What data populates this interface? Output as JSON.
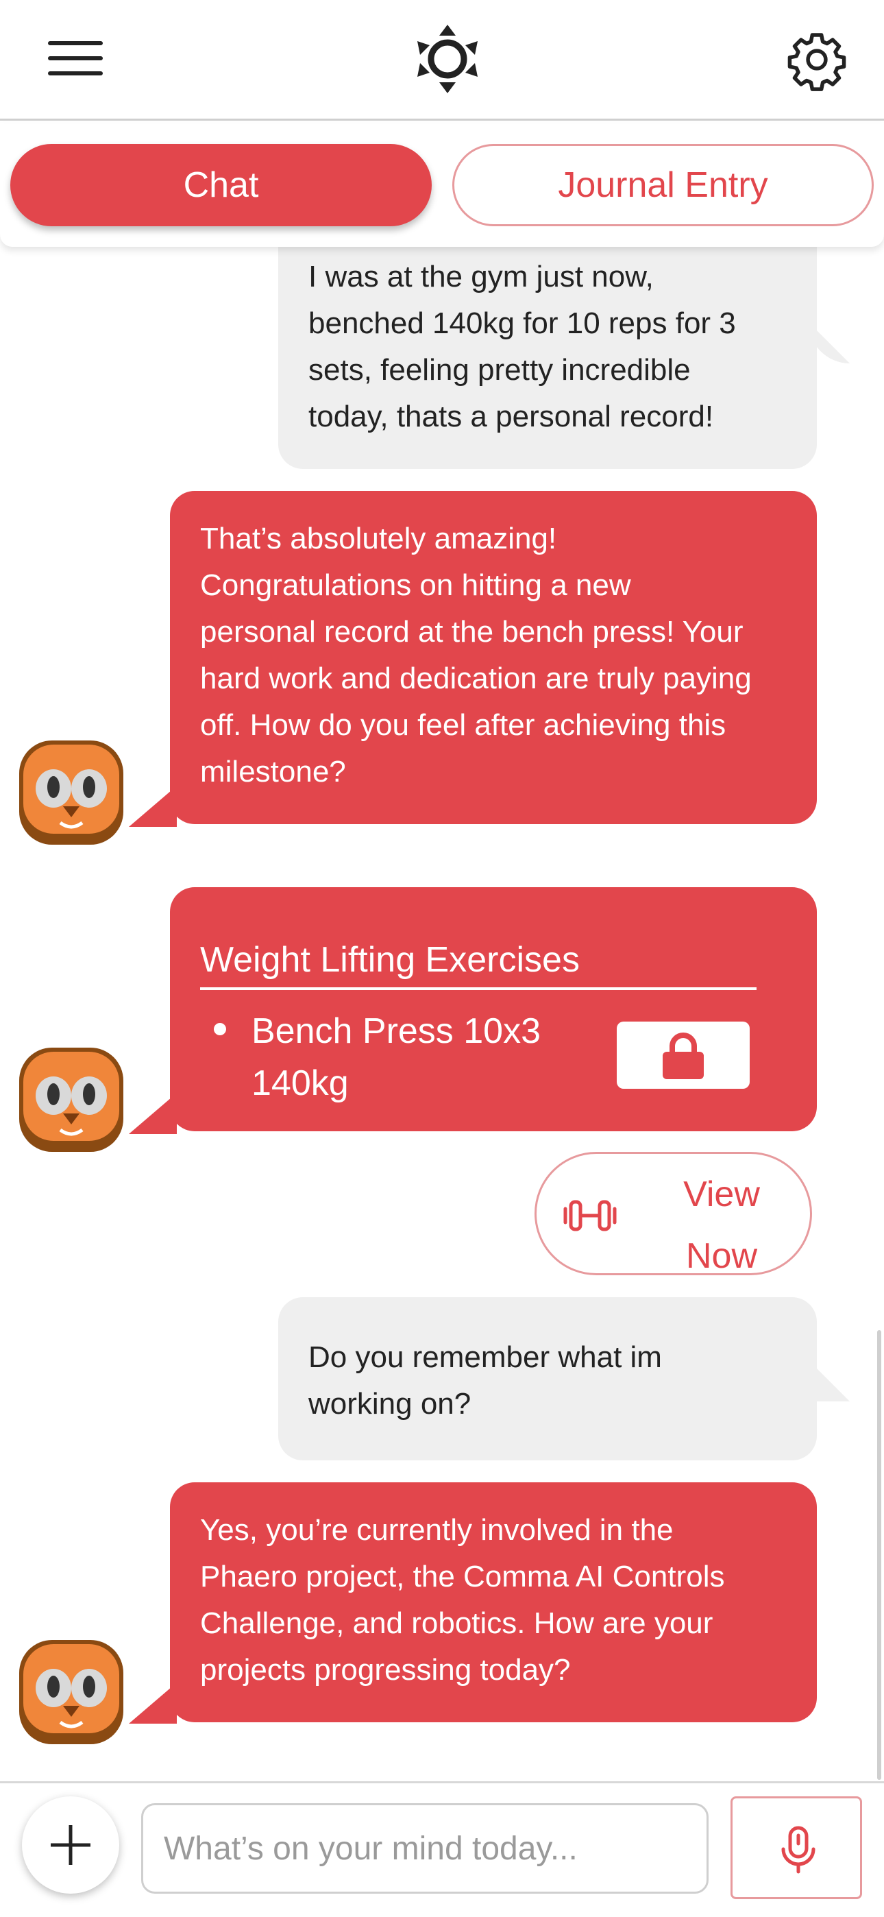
{
  "header": {
    "menu_icon": "hamburger-icon",
    "logo_icon": "sun-logo-icon",
    "settings_icon": "gear-icon"
  },
  "tabs": [
    {
      "label": "Chat",
      "active": true
    },
    {
      "label": "Journal Entry",
      "active": false
    }
  ],
  "messages": {
    "user1": [
      "I was at the gym just now,",
      "benched 140kg for 10 reps for 3",
      "sets, feeling pretty incredible",
      "today, thats a personal record!"
    ],
    "bot1": [
      "That’s absolutely amazing!",
      "Congratulations on hitting a new",
      "personal record at the bench press! Your",
      "hard work and dedication are truly paying",
      "off. How do you feel after achieving this",
      "milestone?"
    ],
    "card": {
      "title": "Weight Lifting Exercises",
      "items": [
        "Bench Press 10x3",
        "140kg"
      ],
      "lock_icon": "lock-icon"
    },
    "view_button": {
      "line1": "View",
      "line2": "Now",
      "icon": "dumbbell-icon"
    },
    "user2": [
      "Do you remember what im",
      "working on?"
    ],
    "bot2": [
      "Yes, you’re currently involved in the",
      "Phaero project, the Comma AI Controls",
      "Challenge, and robotics. How are your",
      "projects progressing today?"
    ]
  },
  "input": {
    "placeholder": "What’s on your mind today...",
    "add_icon": "plus-icon",
    "mic_icon": "microphone-icon"
  },
  "colors": {
    "accent": "#e2464c",
    "user_bubble": "#efefef"
  }
}
